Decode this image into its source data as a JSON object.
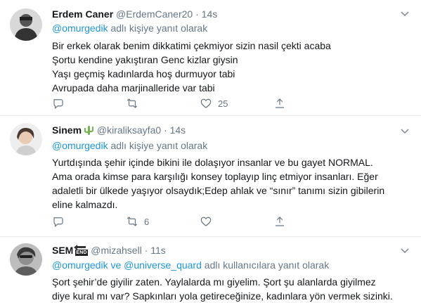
{
  "tweets": [
    {
      "name": "Erdem Caner",
      "handle": "@ErdemCaner20",
      "dot": "·",
      "time": "14s",
      "reply_prefix": "",
      "reply_mention_1": "@omurgedik",
      "reply_and": "",
      "reply_mention_2": "",
      "reply_suffix": " adlı kişiye yanıt olarak",
      "lines": [
        "Bir  erkek olarak benim dikkatimi çekmiyor sizin nasil çekti acaba",
        "Şortu  kendine yakıştıran  Genc kizlar giysin",
        "Yaşı geçmiş kadınlarda hoş durmuyor tabi",
        "Avrupada daha marjinalleride var tabi"
      ],
      "reply_count": "",
      "retweet_count": "",
      "like_count": "25"
    },
    {
      "name": "Sinem",
      "handle": "@kiraliksayfa0",
      "dot": "·",
      "time": "14s",
      "reply_mention_1": "@omurgedik",
      "reply_and": "",
      "reply_mention_2": "",
      "reply_suffix": " adlı kişiye yanıt olarak",
      "lines": [
        "Yurtdışında şehir içinde bikini ile dolaşıyor insanlar ve bu gayet NORMAL.",
        "Ama orada kimse para karşılığı konsey toplayıp linç etmiyor insanları. Eğer",
        "adaletli bir ülkede yaşıyor olsaydık;Edep ahlak ve “sınır” tanımı sizin gibilerin",
        "eline kalmazdı."
      ],
      "reply_count": "",
      "retweet_count": "6",
      "like_count": ""
    },
    {
      "name": "SEM",
      "badge_text": "END",
      "handle": "@mizahsell",
      "dot": "·",
      "time": "11s",
      "reply_mention_1": "@omurgedik",
      "reply_and": " ve ",
      "reply_mention_2": "@universe_quard",
      "reply_suffix": " adlı kullanıcılara yanıt olarak",
      "lines": [
        "Şort şehir’de giyilir zaten. Yaylalarda mı giyelim. Şort şu alanlarda giyilmez",
        "diye kural mı var? Sapkınları yola getireceğinize, kadınlara yön vermek sizinki."
      ]
    }
  ],
  "icons": {
    "reply": "reply-icon",
    "retweet": "retweet-icon",
    "like": "heart-icon",
    "share": "share-icon",
    "more": "chevron-down-icon",
    "cactus": "cactus-emoji-icon"
  },
  "colors": {
    "link": "#1b95e0",
    "secondary": "#657786",
    "divider": "#e6ecf0"
  }
}
